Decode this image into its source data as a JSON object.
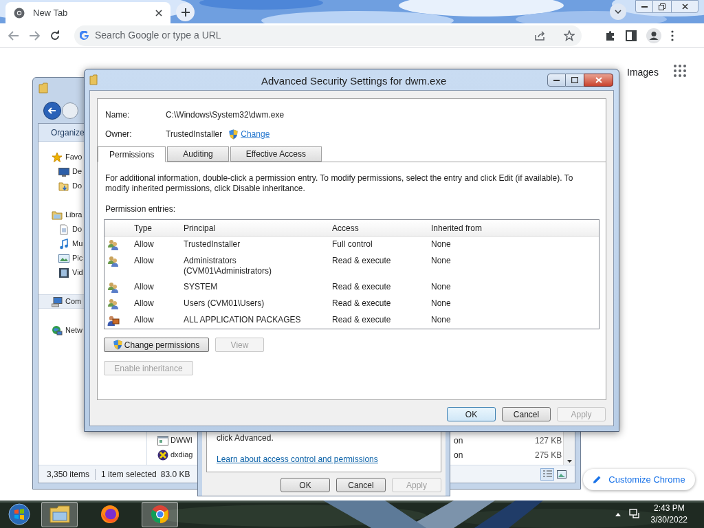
{
  "browser": {
    "tab": {
      "title": "New Tab"
    },
    "address": {
      "placeholder": "Search Google or type a URL"
    },
    "links": [
      "Images"
    ],
    "customize_button": "Customize Chrome"
  },
  "explorer": {
    "toolbar": "Organize",
    "sidebar": [
      {
        "kind": "favorites",
        "label": "Favo",
        "selected": false,
        "children": [
          {
            "kind": "desktop",
            "label": "De",
            "selected": false
          },
          {
            "kind": "downloads",
            "label": "Do",
            "selected": false
          }
        ]
      },
      {
        "kind": "libraries",
        "label": "Libra",
        "selected": false,
        "children": [
          {
            "kind": "documents",
            "label": "Do",
            "selected": false
          },
          {
            "kind": "music",
            "label": "Mu",
            "selected": false
          },
          {
            "kind": "pictures",
            "label": "Pic",
            "selected": false
          },
          {
            "kind": "videos",
            "label": "Vid",
            "selected": false
          }
        ]
      },
      {
        "kind": "computer",
        "label": "Com",
        "selected": true
      },
      {
        "kind": "network",
        "label": "Netw",
        "selected": false
      }
    ],
    "files": [
      {
        "kind": "window",
        "name": "DWWI",
        "type": "on",
        "size": "127 KB"
      },
      {
        "kind": "dx",
        "name": "dxdiag",
        "type": "on",
        "size": "275 KB"
      }
    ],
    "status": {
      "count": "3,350 items",
      "selection": "1 item selected",
      "size": "83.0 KB"
    }
  },
  "properties": {
    "note": "click Advanced.",
    "link": "Learn about access control and permissions",
    "buttons": [
      {
        "label": "OK",
        "disabled": false
      },
      {
        "label": "Cancel",
        "disabled": false
      },
      {
        "label": "Apply",
        "disabled": true
      }
    ]
  },
  "dialog": {
    "title": "Advanced Security Settings for dwm.exe",
    "name_label": "Name:",
    "name_value": "C:\\Windows\\System32\\dwm.exe",
    "owner_label": "Owner:",
    "owner_value": "TrustedInstaller",
    "change_link": "Change",
    "tabs": [
      {
        "label": "Permissions",
        "selected": true
      },
      {
        "label": "Auditing",
        "selected": false
      },
      {
        "label": "Effective Access",
        "selected": false
      }
    ],
    "info": "For additional information, double-click a permission entry. To modify permissions, select the entry and click Edit (if available). To modify inherited permissions, click Disable inheritance.",
    "entries_label": "Permission entries:",
    "table": {
      "columns": [
        "Type",
        "Principal",
        "Access",
        "Inherited from"
      ],
      "rows": [
        {
          "kind": "group",
          "type": "Allow",
          "principal": "TrustedInstaller",
          "access": "Full control",
          "inherited": "None"
        },
        {
          "kind": "group",
          "type": "Allow",
          "principal": "Administrators\n(CVM01\\Administrators)",
          "access": "Read & execute",
          "inherited": "None"
        },
        {
          "kind": "group",
          "type": "Allow",
          "principal": "SYSTEM",
          "access": "Read & execute",
          "inherited": "None"
        },
        {
          "kind": "group",
          "type": "Allow",
          "principal": "Users (CVM01\\Users)",
          "access": "Read & execute",
          "inherited": "None"
        },
        {
          "kind": "package",
          "type": "Allow",
          "principal": "ALL APPLICATION PACKAGES",
          "access": "Read & execute",
          "inherited": "None"
        }
      ]
    },
    "actions": [
      {
        "label": "Change permissions",
        "disabled": false,
        "shield": true
      },
      {
        "label": "View",
        "disabled": true,
        "shield": false
      }
    ],
    "inheritance_button": {
      "label": "Enable inheritance",
      "disabled": true
    },
    "buttons": [
      {
        "label": "OK",
        "disabled": false,
        "default": true
      },
      {
        "label": "Cancel",
        "disabled": false,
        "default": false
      },
      {
        "label": "Apply",
        "disabled": true,
        "default": false
      }
    ]
  },
  "taskbar": {
    "apps": [
      {
        "kind": "explorer",
        "selected": true
      },
      {
        "kind": "firefox",
        "selected": false
      },
      {
        "kind": "chrome",
        "selected": true
      }
    ],
    "time": "2:43 PM",
    "date": "3/30/2022"
  }
}
